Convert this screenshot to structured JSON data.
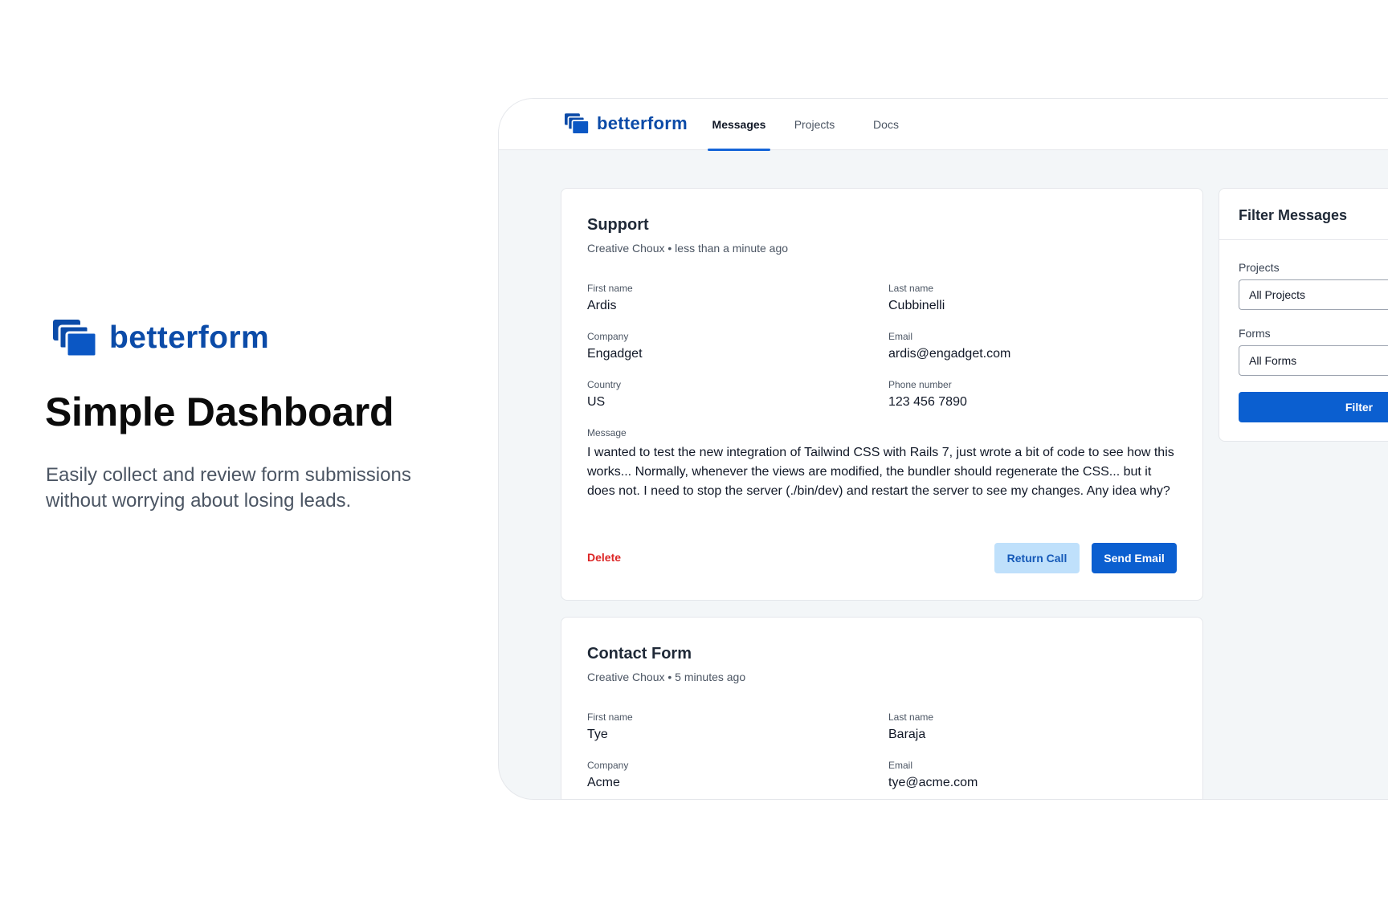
{
  "hero": {
    "brand": "betterform",
    "title": "Simple Dashboard",
    "subtitle": "Easily collect and review form submissions without worrying about losing leads."
  },
  "nav": {
    "brand": "betterform",
    "tabs": [
      {
        "label": "Messages",
        "active": true
      },
      {
        "label": "Projects",
        "active": false
      },
      {
        "label": "Docs",
        "active": false
      }
    ]
  },
  "messages": [
    {
      "title": "Support",
      "meta": "Creative Choux • less than a minute ago",
      "fields": [
        {
          "label": "First name",
          "value": "Ardis"
        },
        {
          "label": "Last name",
          "value": "Cubbinelli"
        },
        {
          "label": "Company",
          "value": "Engadget"
        },
        {
          "label": "Email",
          "value": "ardis@engadget.com"
        },
        {
          "label": "Country",
          "value": "US"
        },
        {
          "label": "Phone number",
          "value": "123 456 7890"
        }
      ],
      "message_label": "Message",
      "message": "I wanted to test the new integration of Tailwind CSS with Rails 7, just wrote a bit of code to see how this works... Normally, whenever the views are modified, the bundler should regenerate the CSS... but it does not. I need to stop the server (./bin/dev) and restart the server to see my changes. Any idea why?",
      "delete_label": "Delete",
      "return_call_label": "Return Call",
      "send_email_label": "Send Email"
    },
    {
      "title": "Contact Form",
      "meta": "Creative Choux • 5 minutes ago",
      "fields": [
        {
          "label": "First name",
          "value": "Tye"
        },
        {
          "label": "Last name",
          "value": "Baraja"
        },
        {
          "label": "Company",
          "value": "Acme"
        },
        {
          "label": "Email",
          "value": "tye@acme.com"
        }
      ]
    }
  ],
  "filter": {
    "title": "Filter Messages",
    "projects_label": "Projects",
    "projects_value": "All Projects",
    "forms_label": "Forms",
    "forms_value": "All Forms",
    "button_label": "Filter"
  },
  "colors": {
    "brand": "#0b4ba8",
    "primary": "#0b5fd0",
    "secondary_bg": "#bfe0fb",
    "danger": "#dc2626"
  }
}
